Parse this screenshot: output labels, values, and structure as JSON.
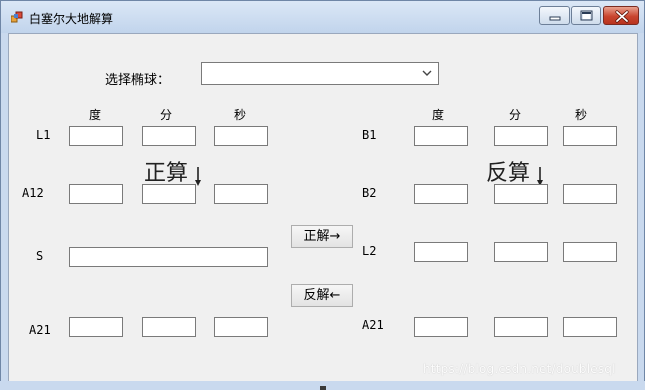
{
  "window": {
    "title": "白塞尔大地解算",
    "minimize_label": "",
    "maximize_label": "",
    "close_label": ""
  },
  "ellipsoid": {
    "label": "选择椭球：",
    "selected": ""
  },
  "headers": {
    "left": {
      "deg": "度",
      "min": "分",
      "sec": "秒"
    },
    "right": {
      "deg": "度",
      "min": "分",
      "sec": "秒"
    }
  },
  "section": {
    "forward": "正算",
    "inverse": "反算"
  },
  "left_fields": {
    "L1": {
      "label": "L1",
      "deg": "",
      "min": "",
      "sec": ""
    },
    "A12": {
      "label": "A12",
      "deg": "",
      "min": "",
      "sec": ""
    },
    "S": {
      "label": "S",
      "value": ""
    },
    "A21": {
      "label": "A21",
      "deg": "",
      "min": "",
      "sec": ""
    }
  },
  "right_fields": {
    "B1": {
      "label": "B1",
      "deg": "",
      "min": "",
      "sec": ""
    },
    "B2": {
      "label": "B2",
      "deg": "",
      "min": "",
      "sec": ""
    },
    "L2": {
      "label": "L2",
      "deg": "",
      "min": "",
      "sec": ""
    },
    "A21": {
      "label": "A21",
      "deg": "",
      "min": "",
      "sec": ""
    }
  },
  "buttons": {
    "forward": "正解→",
    "inverse": "反解←"
  },
  "watermark": "https://blog.csdn.net/doublesql",
  "colors": {
    "titlebar": "#c9d9ee",
    "client": "#f0f0f0",
    "close_button": "#c9452f"
  }
}
